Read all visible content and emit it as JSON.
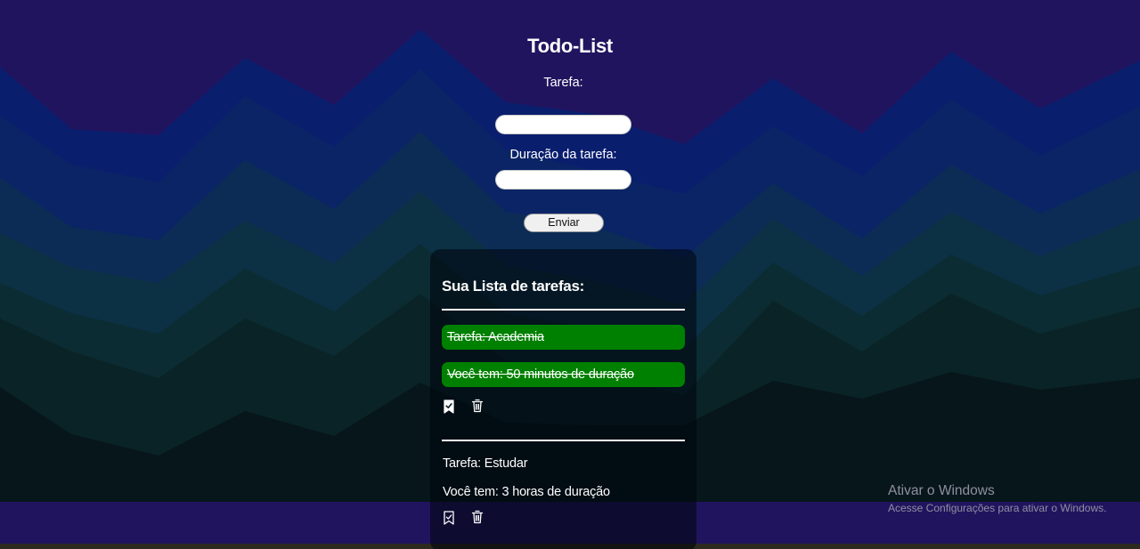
{
  "app": {
    "title": "Todo-List"
  },
  "form": {
    "task_label": "Tarefa:",
    "task_value": "",
    "duration_label": "Duração da tarefa:",
    "duration_value": "",
    "submit_label": "Enviar"
  },
  "list": {
    "title": "Sua Lista de tarefas:",
    "items": [
      {
        "task": "Tarefa: Academia",
        "duration": "Você tem: 50 minutos de duração",
        "completed": true,
        "highlight_color": "#008000",
        "complete_icon": "bookmark-check-filled-icon",
        "delete_icon": "trash-icon"
      },
      {
        "task": "Tarefa: Estudar",
        "duration": "Você tem: 3 horas de duração",
        "completed": false,
        "complete_icon": "bookmark-check-outline-icon",
        "delete_icon": "trash-icon"
      }
    ]
  },
  "watermark": {
    "title": "Ativar o Windows",
    "subtitle": "Acesse Configurações para ativar o Windows."
  },
  "colors": {
    "background_top": "#21145f",
    "background_bottom": "#060b0c",
    "done_green": "#008000"
  }
}
